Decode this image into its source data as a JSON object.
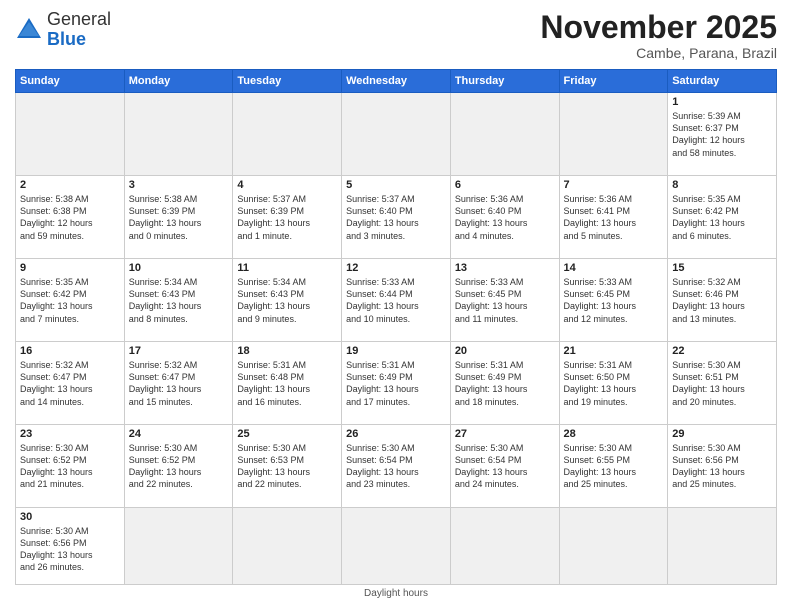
{
  "header": {
    "logo_general": "General",
    "logo_blue": "Blue",
    "month_title": "November 2025",
    "location": "Cambe, Parana, Brazil"
  },
  "weekdays": [
    "Sunday",
    "Monday",
    "Tuesday",
    "Wednesday",
    "Thursday",
    "Friday",
    "Saturday"
  ],
  "footer": "Daylight hours",
  "days": [
    {
      "num": "",
      "info": ""
    },
    {
      "num": "",
      "info": ""
    },
    {
      "num": "",
      "info": ""
    },
    {
      "num": "",
      "info": ""
    },
    {
      "num": "",
      "info": ""
    },
    {
      "num": "",
      "info": ""
    },
    {
      "num": "1",
      "info": "Sunrise: 5:39 AM\nSunset: 6:37 PM\nDaylight: 12 hours\nand 58 minutes."
    },
    {
      "num": "2",
      "info": "Sunrise: 5:38 AM\nSunset: 6:38 PM\nDaylight: 12 hours\nand 59 minutes."
    },
    {
      "num": "3",
      "info": "Sunrise: 5:38 AM\nSunset: 6:39 PM\nDaylight: 13 hours\nand 0 minutes."
    },
    {
      "num": "4",
      "info": "Sunrise: 5:37 AM\nSunset: 6:39 PM\nDaylight: 13 hours\nand 1 minute."
    },
    {
      "num": "5",
      "info": "Sunrise: 5:37 AM\nSunset: 6:40 PM\nDaylight: 13 hours\nand 3 minutes."
    },
    {
      "num": "6",
      "info": "Sunrise: 5:36 AM\nSunset: 6:40 PM\nDaylight: 13 hours\nand 4 minutes."
    },
    {
      "num": "7",
      "info": "Sunrise: 5:36 AM\nSunset: 6:41 PM\nDaylight: 13 hours\nand 5 minutes."
    },
    {
      "num": "8",
      "info": "Sunrise: 5:35 AM\nSunset: 6:42 PM\nDaylight: 13 hours\nand 6 minutes."
    },
    {
      "num": "9",
      "info": "Sunrise: 5:35 AM\nSunset: 6:42 PM\nDaylight: 13 hours\nand 7 minutes."
    },
    {
      "num": "10",
      "info": "Sunrise: 5:34 AM\nSunset: 6:43 PM\nDaylight: 13 hours\nand 8 minutes."
    },
    {
      "num": "11",
      "info": "Sunrise: 5:34 AM\nSunset: 6:43 PM\nDaylight: 13 hours\nand 9 minutes."
    },
    {
      "num": "12",
      "info": "Sunrise: 5:33 AM\nSunset: 6:44 PM\nDaylight: 13 hours\nand 10 minutes."
    },
    {
      "num": "13",
      "info": "Sunrise: 5:33 AM\nSunset: 6:45 PM\nDaylight: 13 hours\nand 11 minutes."
    },
    {
      "num": "14",
      "info": "Sunrise: 5:33 AM\nSunset: 6:45 PM\nDaylight: 13 hours\nand 12 minutes."
    },
    {
      "num": "15",
      "info": "Sunrise: 5:32 AM\nSunset: 6:46 PM\nDaylight: 13 hours\nand 13 minutes."
    },
    {
      "num": "16",
      "info": "Sunrise: 5:32 AM\nSunset: 6:47 PM\nDaylight: 13 hours\nand 14 minutes."
    },
    {
      "num": "17",
      "info": "Sunrise: 5:32 AM\nSunset: 6:47 PM\nDaylight: 13 hours\nand 15 minutes."
    },
    {
      "num": "18",
      "info": "Sunrise: 5:31 AM\nSunset: 6:48 PM\nDaylight: 13 hours\nand 16 minutes."
    },
    {
      "num": "19",
      "info": "Sunrise: 5:31 AM\nSunset: 6:49 PM\nDaylight: 13 hours\nand 17 minutes."
    },
    {
      "num": "20",
      "info": "Sunrise: 5:31 AM\nSunset: 6:49 PM\nDaylight: 13 hours\nand 18 minutes."
    },
    {
      "num": "21",
      "info": "Sunrise: 5:31 AM\nSunset: 6:50 PM\nDaylight: 13 hours\nand 19 minutes."
    },
    {
      "num": "22",
      "info": "Sunrise: 5:30 AM\nSunset: 6:51 PM\nDaylight: 13 hours\nand 20 minutes."
    },
    {
      "num": "23",
      "info": "Sunrise: 5:30 AM\nSunset: 6:52 PM\nDaylight: 13 hours\nand 21 minutes."
    },
    {
      "num": "24",
      "info": "Sunrise: 5:30 AM\nSunset: 6:52 PM\nDaylight: 13 hours\nand 22 minutes."
    },
    {
      "num": "25",
      "info": "Sunrise: 5:30 AM\nSunset: 6:53 PM\nDaylight: 13 hours\nand 22 minutes."
    },
    {
      "num": "26",
      "info": "Sunrise: 5:30 AM\nSunset: 6:54 PM\nDaylight: 13 hours\nand 23 minutes."
    },
    {
      "num": "27",
      "info": "Sunrise: 5:30 AM\nSunset: 6:54 PM\nDaylight: 13 hours\nand 24 minutes."
    },
    {
      "num": "28",
      "info": "Sunrise: 5:30 AM\nSunset: 6:55 PM\nDaylight: 13 hours\nand 25 minutes."
    },
    {
      "num": "29",
      "info": "Sunrise: 5:30 AM\nSunset: 6:56 PM\nDaylight: 13 hours\nand 25 minutes."
    },
    {
      "num": "30",
      "info": "Sunrise: 5:30 AM\nSunset: 6:56 PM\nDaylight: 13 hours\nand 26 minutes."
    },
    {
      "num": "",
      "info": ""
    },
    {
      "num": "",
      "info": ""
    },
    {
      "num": "",
      "info": ""
    },
    {
      "num": "",
      "info": ""
    },
    {
      "num": "",
      "info": ""
    },
    {
      "num": "",
      "info": ""
    }
  ]
}
